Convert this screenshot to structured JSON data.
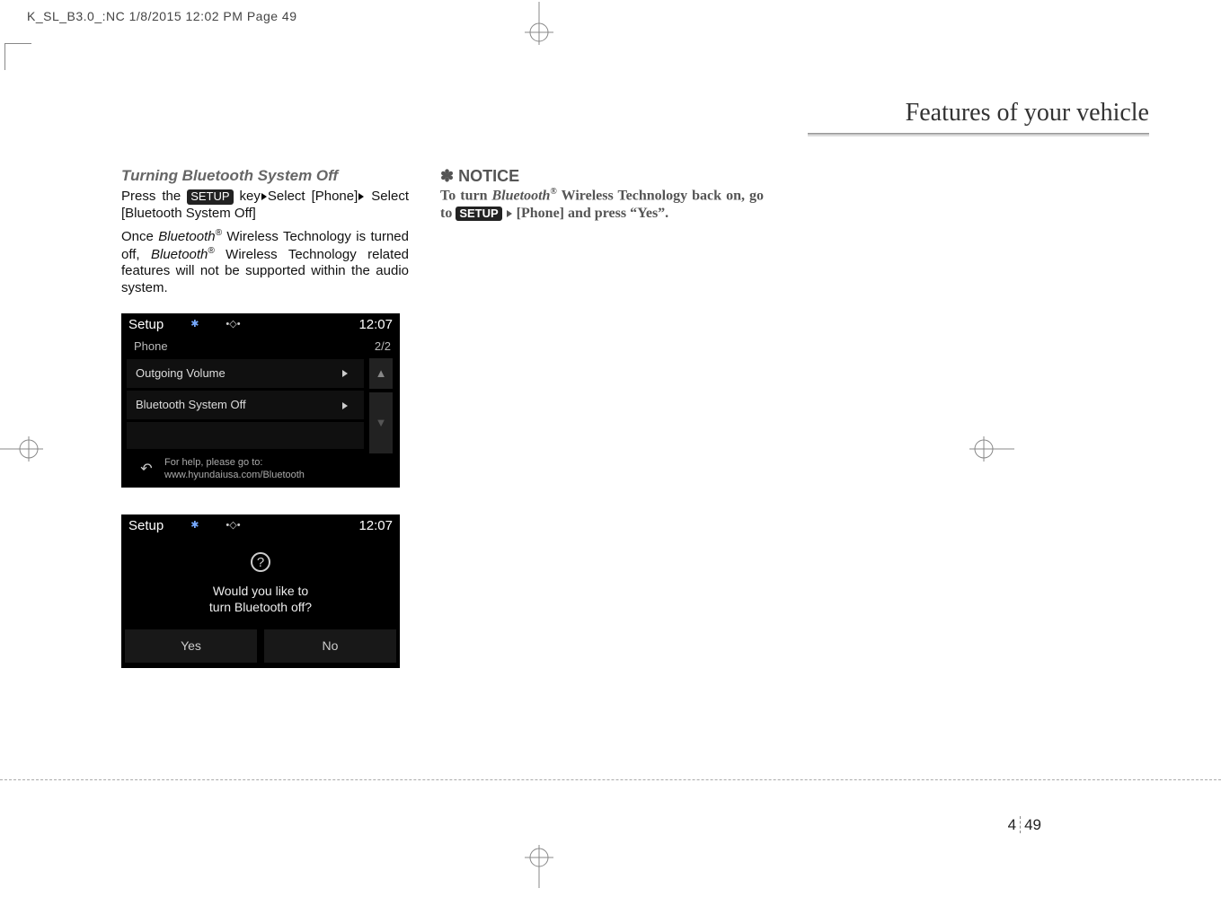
{
  "header": "K_SL_B3.0_:NC  1/8/2015  12:02 PM  Page 49",
  "section_title": "Features of your vehicle",
  "col1": {
    "subhead": "Turning Bluetooth System Off",
    "line1_a": "Press the ",
    "line1_btn": "SETUP",
    "line1_b": " key",
    "line1_c": "Select [Phone]",
    "line1_d": "Select [Bluetooth System Off]",
    "para2_a": "Once ",
    "para2_bt1": "Bluetooth",
    "para2_reg1": "®",
    "para2_b": "  Wireless Technology is turned off, ",
    "para2_bt2": "Bluetooth",
    "para2_reg2": "®",
    "para2_c": "  Wireless Technology related features will not be supported within the audio system."
  },
  "shot1": {
    "title": "Setup",
    "clock": "12:07",
    "sub": "Phone",
    "page": "2/2",
    "row1": "Outgoing Volume",
    "row2": "Bluetooth System Off",
    "foot1": "For help, please go to:",
    "foot2": "www.hyundaiusa.com/Bluetooth"
  },
  "shot2": {
    "title": "Setup",
    "clock": "12:07",
    "msg1": "Would you like to",
    "msg2": "turn Bluetooth off?",
    "yes": "Yes",
    "no": "No"
  },
  "col2": {
    "star": "✽",
    "notice": " NOTICE",
    "body_a": "To turn ",
    "body_bt": "Bluetooth",
    "body_reg": "®",
    "body_b": "  Wireless Technology back on, go to ",
    "body_btn": "SETUP",
    "body_c": "[Phone] and press “Yes”."
  },
  "page_num_a": "4",
  "page_num_b": "49"
}
